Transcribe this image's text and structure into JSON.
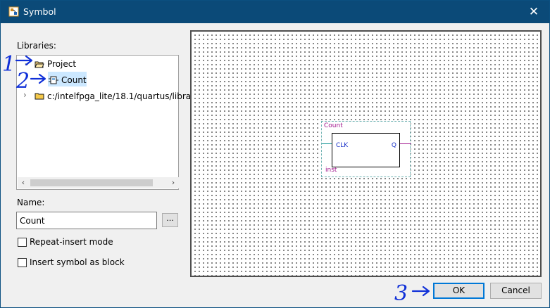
{
  "window": {
    "title": "Symbol",
    "close_glyph": "✕"
  },
  "libraries": {
    "label": "Libraries:",
    "tree": [
      {
        "label": "Project",
        "icon": "folder-open-icon",
        "expanded": true
      },
      {
        "label": "Count",
        "icon": "symbol-component-icon",
        "selected": true
      },
      {
        "label": "c:/intelfpga_lite/18.1/quartus/libra",
        "icon": "folder-icon",
        "expanded": false
      }
    ]
  },
  "name": {
    "label": "Name:",
    "value": "Count",
    "browse_label": "..."
  },
  "options": {
    "repeat_insert": {
      "label": "Repeat-insert mode",
      "checked": false
    },
    "insert_as_block": {
      "label": "Insert symbol as block",
      "checked": false
    }
  },
  "preview": {
    "symbol_name": "Count",
    "instance": "inst",
    "input_pin": "CLK",
    "output_pin": "Q"
  },
  "buttons": {
    "ok": "OK",
    "cancel": "Cancel"
  },
  "annotations": {
    "step1": "1",
    "step2": "2",
    "step3": "3"
  },
  "colors": {
    "titlebar": "#0b4a78",
    "annotation": "#1030d8",
    "selection": "#cce8ff",
    "pin_text": "#1a32c8",
    "symbol_label": "#a0148c"
  }
}
